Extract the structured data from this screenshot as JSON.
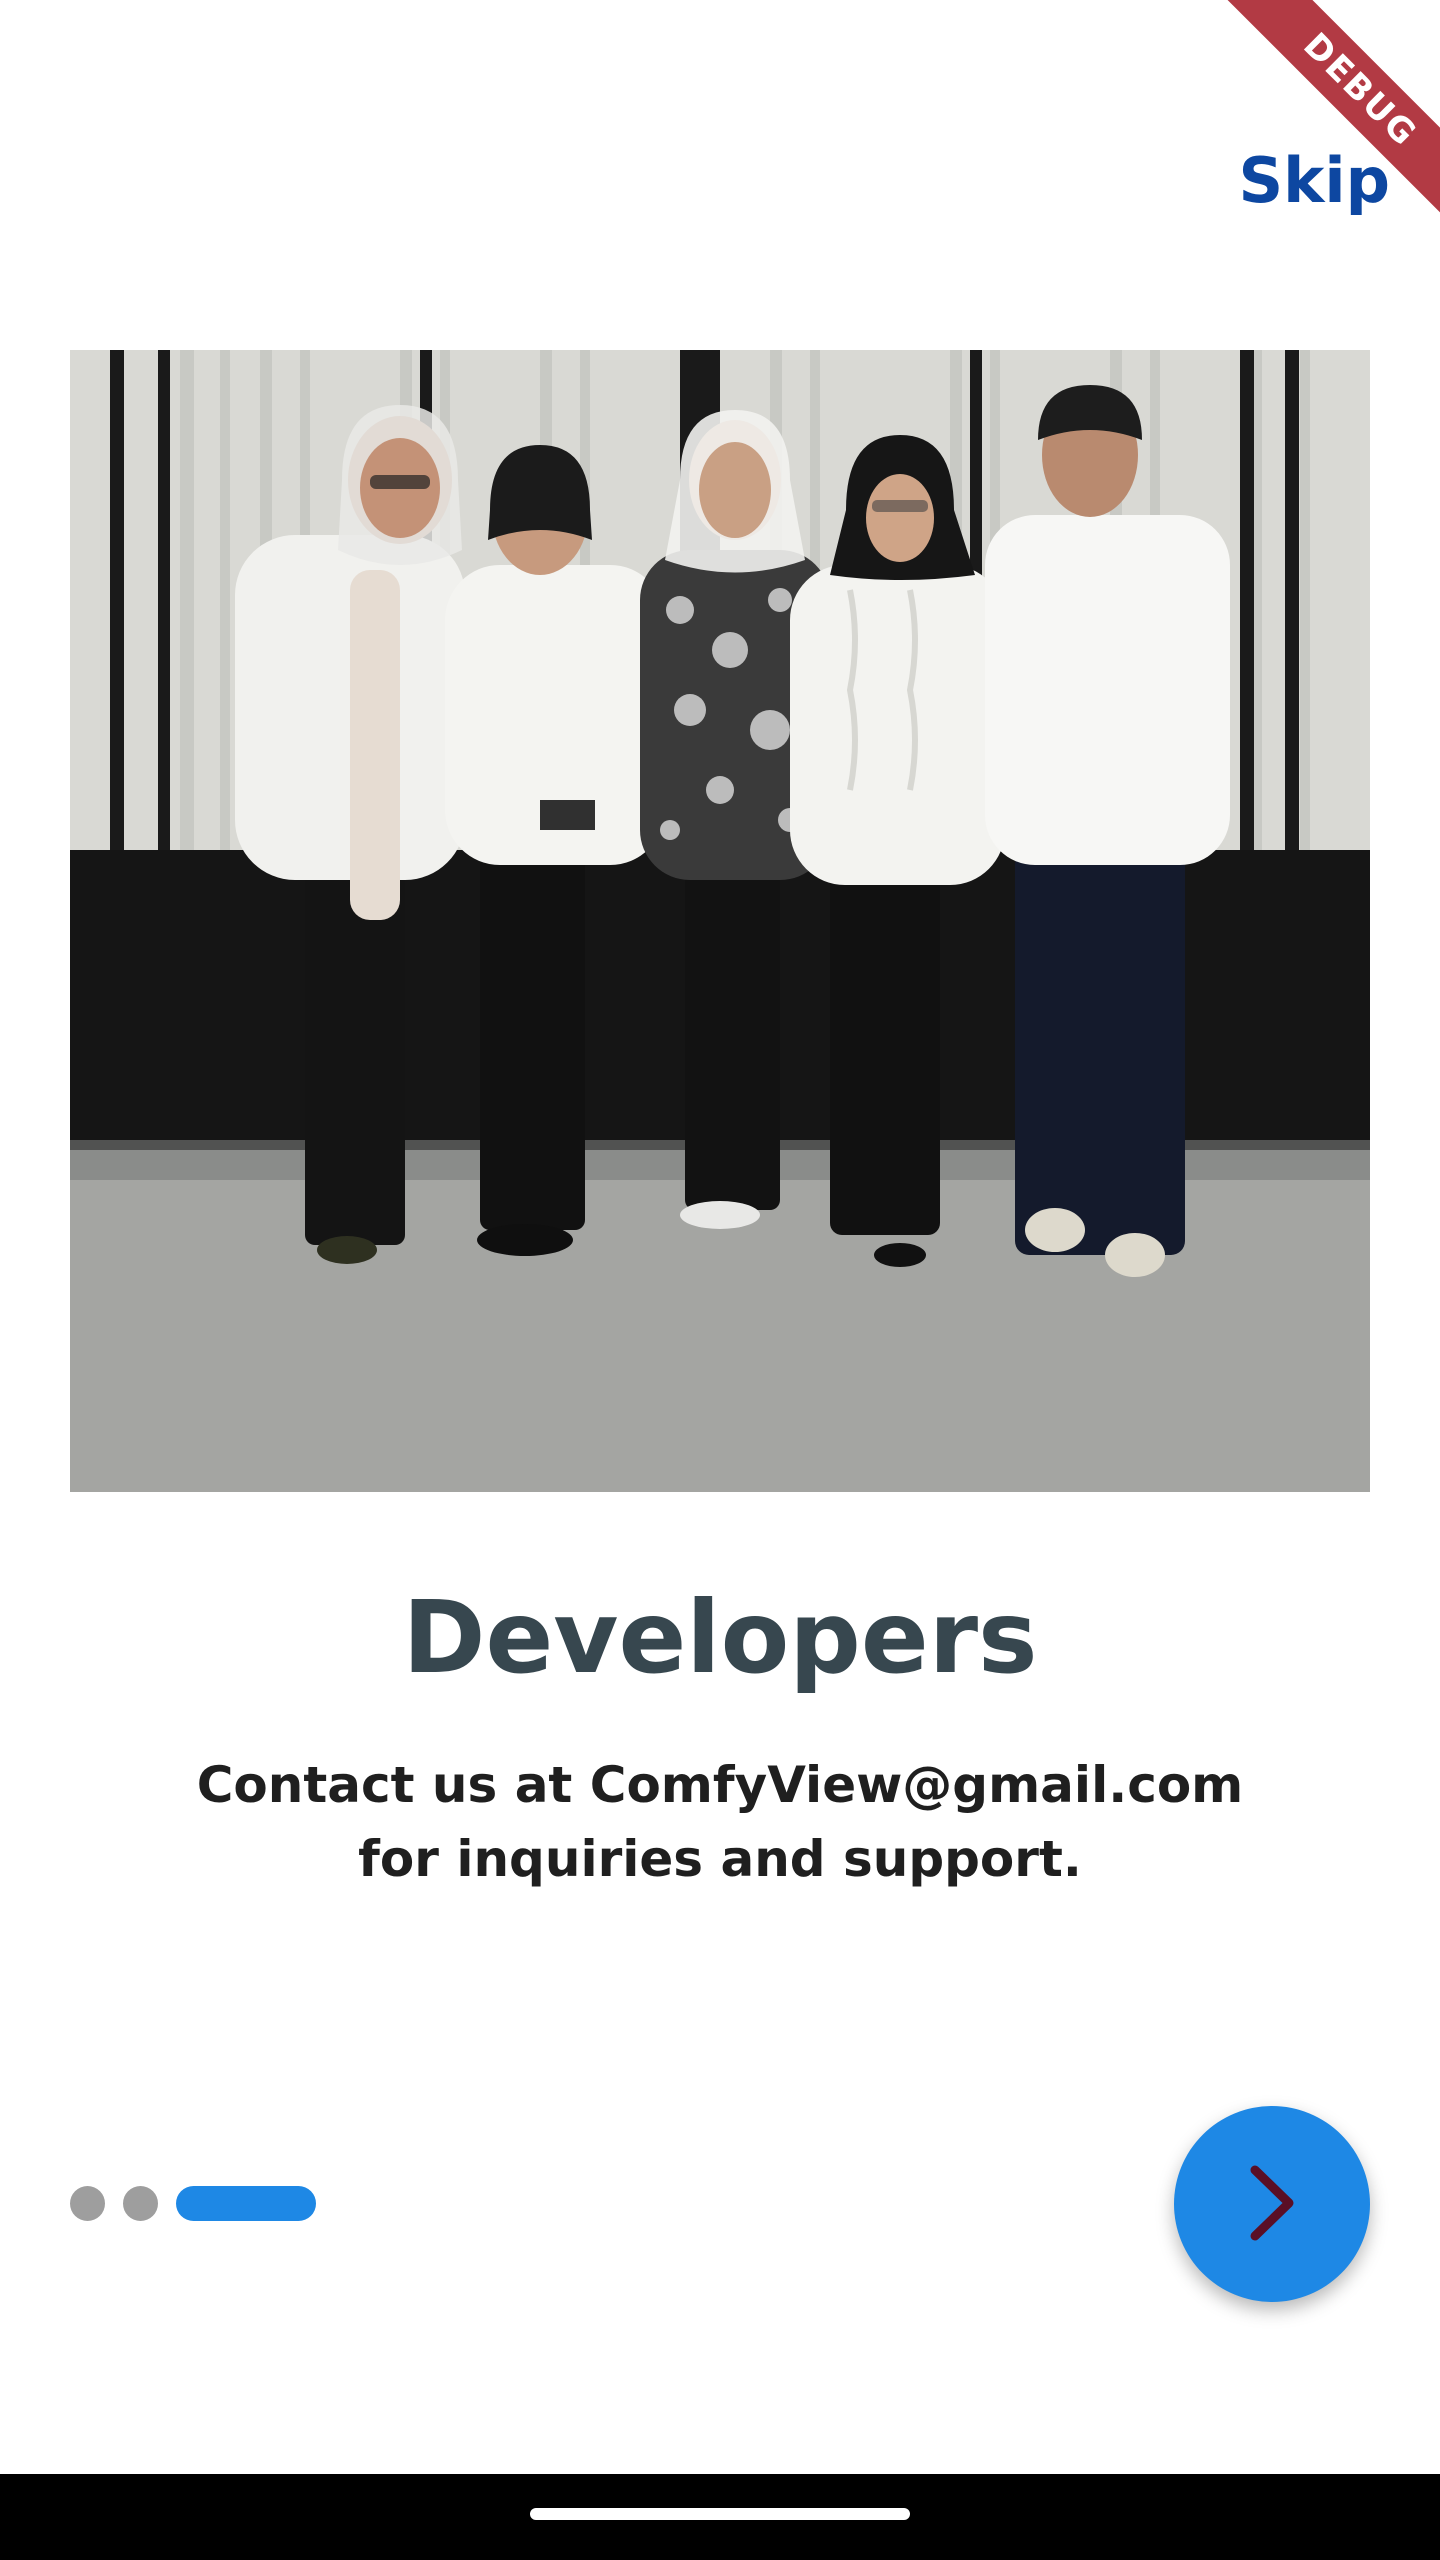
{
  "debug_banner": {
    "label": "DEBUG"
  },
  "header": {
    "skip_label": "Skip"
  },
  "slide": {
    "image_alt": "Developers team photo",
    "title": "Developers",
    "description": "Contact us at ComfyView@gmail.com for inquiries and support."
  },
  "pager": {
    "pages": 3,
    "current": 3
  },
  "colors": {
    "accent": "#1e88e5",
    "skip": "#0d47a1",
    "title": "#37474f",
    "dot_inactive": "#9e9e9e",
    "debug": "#b23a44",
    "arrow": "#5a0f26"
  },
  "icons": {
    "next": "chevron-right-icon"
  }
}
